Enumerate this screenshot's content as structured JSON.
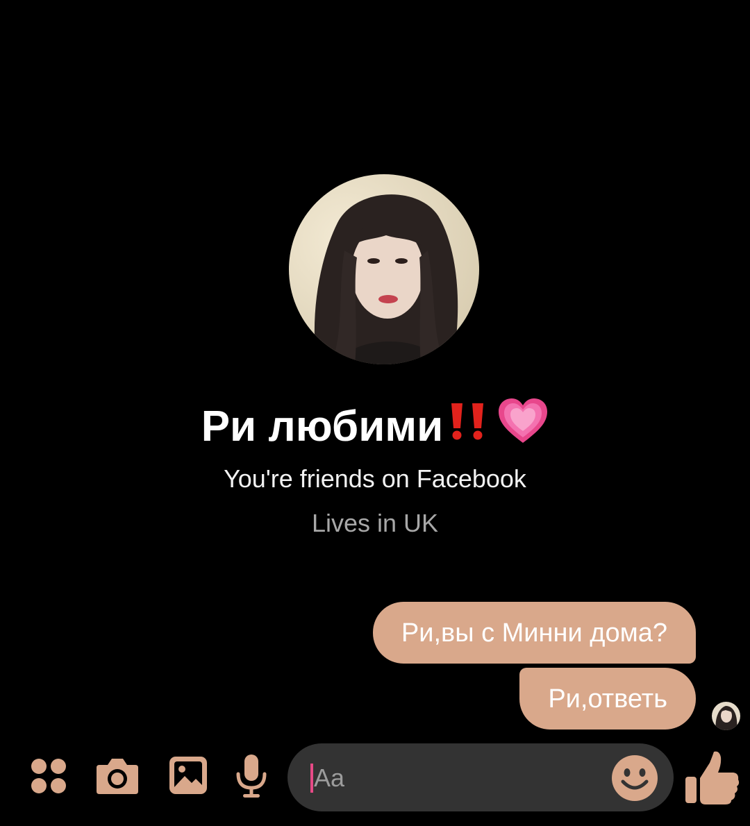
{
  "theme": {
    "background": "#000000",
    "accent": "#d9a88b",
    "composer_bg": "#333333",
    "caret": "#e64a86"
  },
  "profile": {
    "name": "Ри любими",
    "name_emoji": [
      "double-exclamation-mark",
      "growing-heart"
    ],
    "friends_text": "You're friends on Facebook",
    "location_text": "Lives in UK"
  },
  "messages": [
    {
      "text": "Ри,вы с Минни дома?",
      "sender": "me"
    },
    {
      "text": "Ри,ответь",
      "sender": "me"
    }
  ],
  "composer": {
    "placeholder": "Aa",
    "icons": [
      "apps-icon",
      "camera-icon",
      "gallery-icon",
      "microphone-icon",
      "emoji-icon",
      "thumbs-up-icon"
    ]
  }
}
